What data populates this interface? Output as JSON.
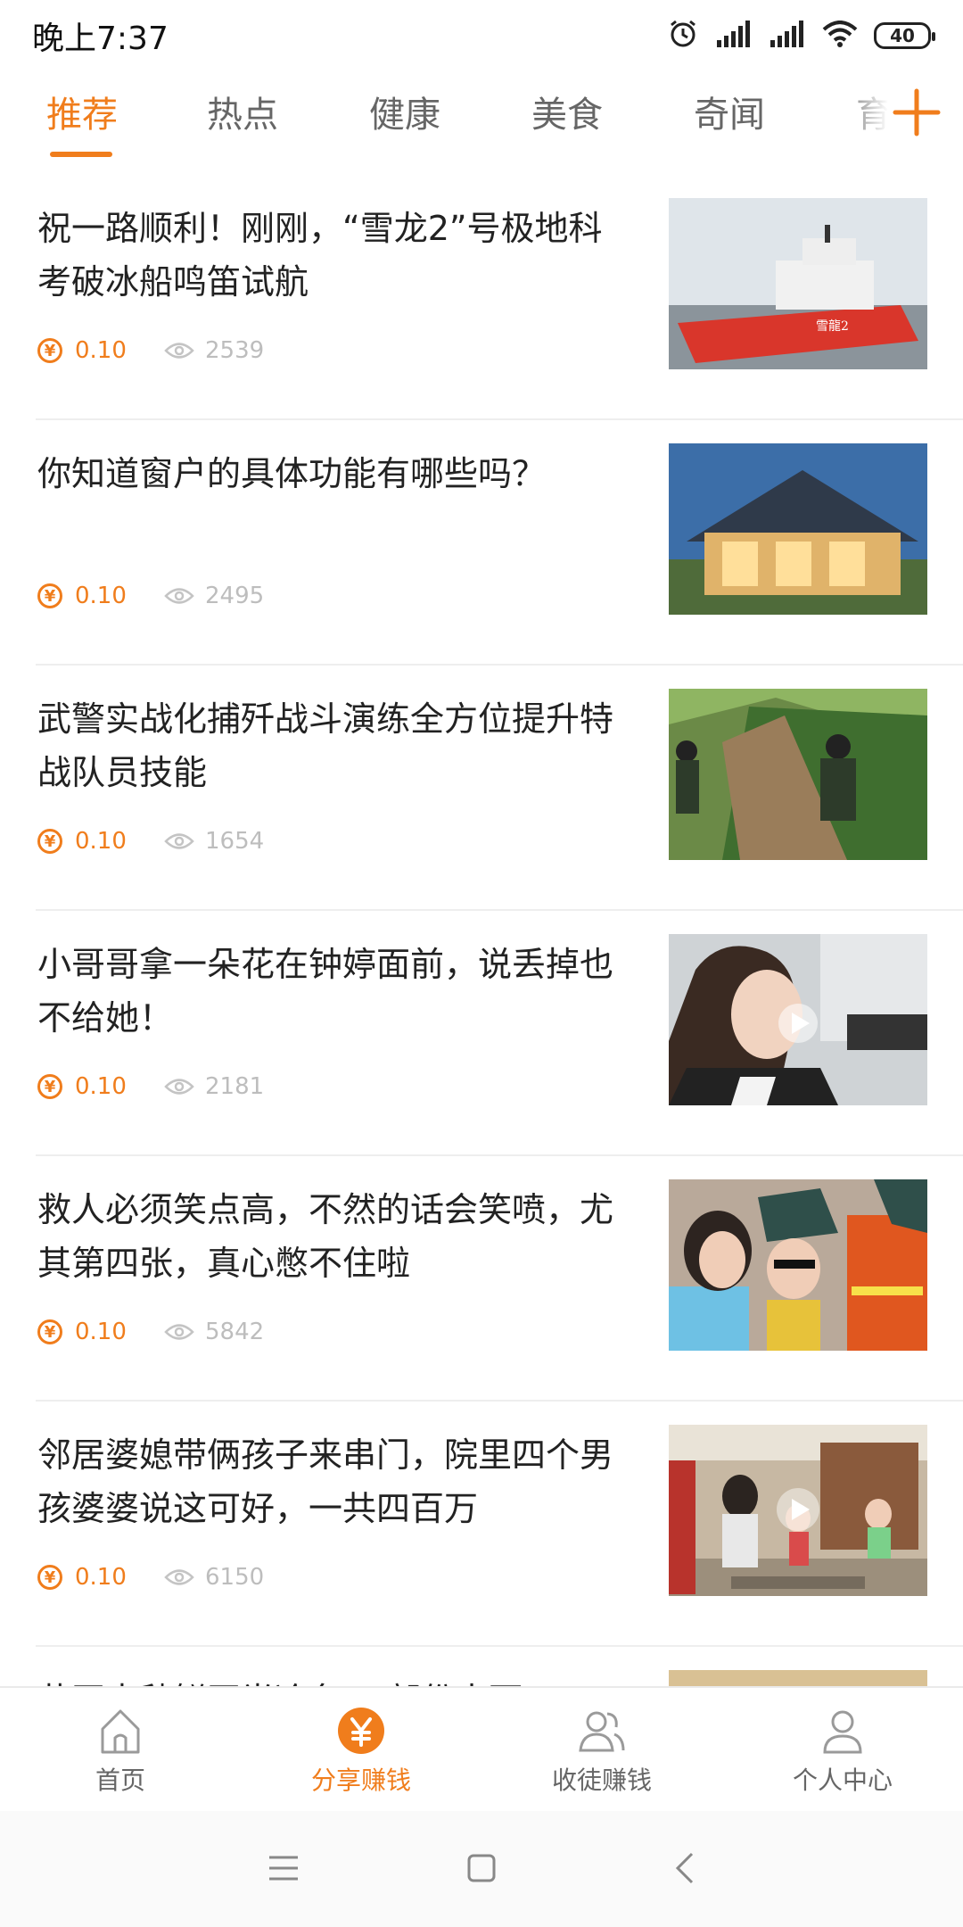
{
  "status_bar": {
    "time": "晚上7:37",
    "battery": "40",
    "icons": [
      "alarm-icon",
      "signal-icon",
      "signal-icon",
      "wifi-icon",
      "battery-icon"
    ]
  },
  "tabs": [
    {
      "label": "推荐",
      "active": true
    },
    {
      "label": "热点",
      "active": false
    },
    {
      "label": "健康",
      "active": false
    },
    {
      "label": "美食",
      "active": false
    },
    {
      "label": "奇闻",
      "active": false
    },
    {
      "label": "育",
      "active": false
    }
  ],
  "feed": [
    {
      "title": "祝一路顺利！刚刚，“雪龙2”号极地科考破冰船鸣笛试航",
      "reward": "0.10",
      "views": "2539",
      "thumb_text": "雪龍2"
    },
    {
      "title": "你知道窗户的具体功能有哪些吗？",
      "reward": "0.10",
      "views": "2495"
    },
    {
      "title": "武警实战化捕歼战斗演练全方位提升特战队员技能",
      "reward": "0.10",
      "views": "1654"
    },
    {
      "title": "小哥哥拿一朵花在钟婷面前，说丢掉也不给她！",
      "reward": "0.10",
      "views": "2181"
    },
    {
      "title": "救人必须笑点高，不然的话会笑喷，尤其第四张，真心憋不住啦",
      "reward": "0.10",
      "views": "5842"
    },
    {
      "title": "邻居婆媳带俩孩子来串门，院里四个男孩婆婆说这可好，一共四百万",
      "reward": "0.10",
      "views": "6150"
    },
    {
      "title": "花开中秋鲜开半冷冬口 部份出面",
      "reward": "",
      "views": ""
    }
  ],
  "bottom_nav": [
    {
      "label": "首页",
      "icon": "home-icon",
      "active": false
    },
    {
      "label": "分享赚钱",
      "icon": "yuan-coin-icon",
      "active": true
    },
    {
      "label": "收徒赚钱",
      "icon": "users-icon",
      "active": false
    },
    {
      "label": "个人中心",
      "icon": "person-icon",
      "active": false
    }
  ],
  "colors": {
    "accent": "#f07d1c",
    "muted": "#bdbdbd"
  }
}
